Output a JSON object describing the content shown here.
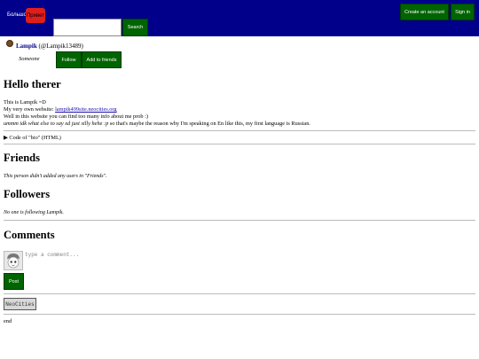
{
  "header": {
    "logo_text": "Большой",
    "logo_badge": "Привет",
    "search_placeholder": "",
    "search_button": "Search",
    "create_account": "Create an account",
    "sign_in": "Sign in"
  },
  "profile": {
    "display_name": "Lampik",
    "handle": "(@Lampik13489)",
    "status": "Someone",
    "follow": "Follow",
    "add_to_friends": "Add to friends"
  },
  "bio": {
    "heading": "Hello therer",
    "line1": "This is Lampik =D",
    "line2_prefix": "My very own website: ",
    "link_text": "lampik499site.neocities.org",
    "line3": "Well in this website you can find too many info about me prob :)",
    "line4_italic": "ummm idk what else to say xd just silly hehe :p",
    "line4_rest": " so that's maybe the reason why I'm speaking on En like this, my first language is Russian.",
    "details_summary": "Code of \"bio\" (HTML)"
  },
  "friends": {
    "heading": "Friends",
    "empty": "This person didn't added any users in \"Friends\"."
  },
  "followers": {
    "heading": "Followers",
    "empty": "No one is following Lampik."
  },
  "comments": {
    "heading": "Comments",
    "placeholder": "type a comment...",
    "post": "Post"
  },
  "footer": {
    "neocities": "NeoCities",
    "end": "end"
  }
}
